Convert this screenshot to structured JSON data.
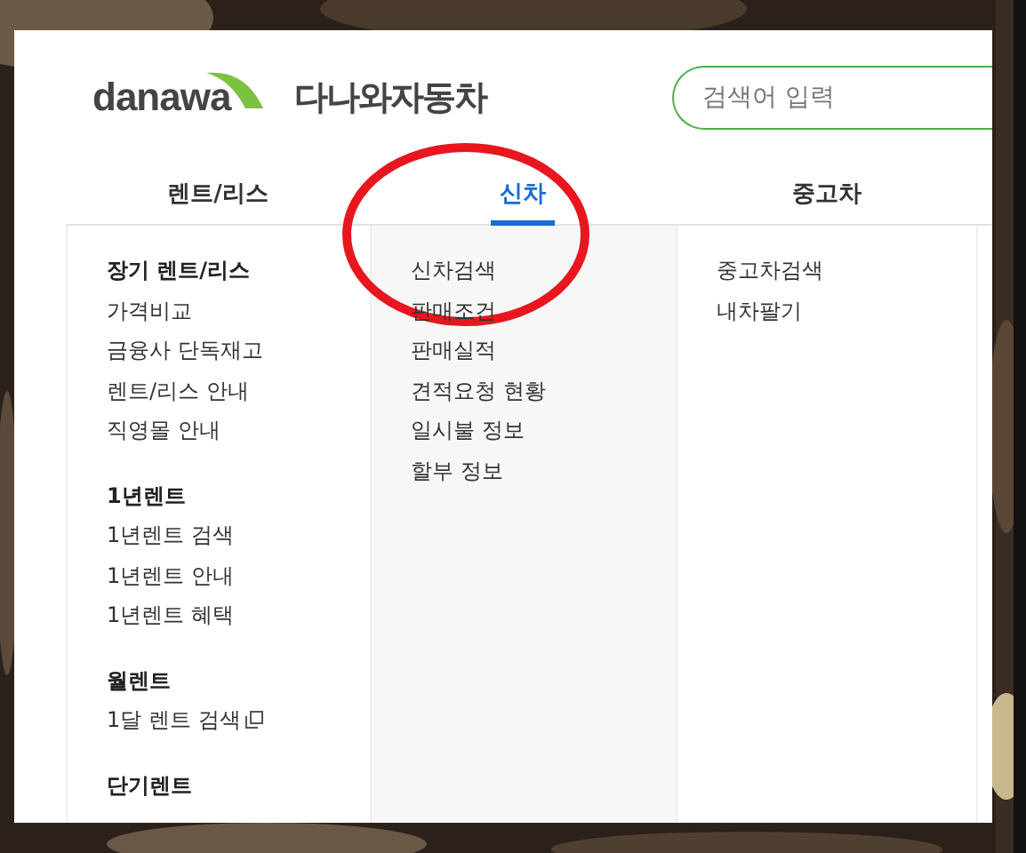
{
  "logo": {
    "wordmark": "danawa",
    "service": "다나와자동차"
  },
  "search": {
    "placeholder": "검색어 입력"
  },
  "tabs": [
    {
      "label": "렌트/리스",
      "selected": false
    },
    {
      "label": "신차",
      "selected": true
    },
    {
      "label": "중고차",
      "selected": false
    }
  ],
  "columns": [
    {
      "sections": [
        {
          "heading": "장기 렌트/리스",
          "items": [
            {
              "label": "가격비교",
              "external": false
            },
            {
              "label": "금융사 단독재고",
              "external": false
            },
            {
              "label": "렌트/리스 안내",
              "external": false
            },
            {
              "label": "직영몰 안내",
              "external": false
            }
          ]
        },
        {
          "heading": "1년렌트",
          "items": [
            {
              "label": "1년렌트 검색",
              "external": false
            },
            {
              "label": "1년렌트 안내",
              "external": false
            },
            {
              "label": "1년렌트 혜택",
              "external": false
            }
          ]
        },
        {
          "heading": "월렌트",
          "items": [
            {
              "label": "1달 렌트 검색",
              "external": true
            }
          ]
        },
        {
          "heading": "단기렌트"
        }
      ]
    },
    {
      "sections": [
        {
          "items": [
            {
              "label": "신차검색",
              "external": false
            },
            {
              "label": "판매조건",
              "external": false
            },
            {
              "label": "판매실적",
              "external": false
            },
            {
              "label": "견적요청 현황",
              "external": false
            },
            {
              "label": "일시불 정보",
              "external": false
            },
            {
              "label": "할부 정보",
              "external": false
            }
          ]
        }
      ]
    },
    {
      "sections": [
        {
          "items": [
            {
              "label": "중고차검색",
              "external": false
            },
            {
              "label": "내차팔기",
              "external": false
            }
          ]
        }
      ]
    }
  ]
}
